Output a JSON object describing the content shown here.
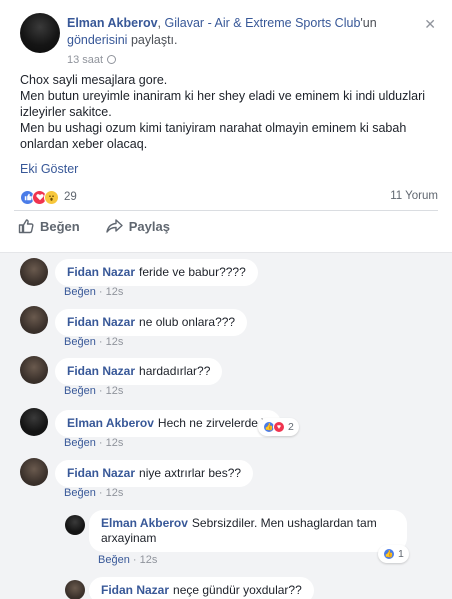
{
  "post": {
    "author": "Elman Akberov",
    "separator": ", ",
    "club": "Gilavar - Air & Extreme Sports Club",
    "club_suffix": "'un",
    "shared_word": "gönderisini",
    "shared_tail": " paylaştı.",
    "time": "13 saat",
    "close_glyph": "✕",
    "text_lines": [
      "Chox sayli mesajlara gore.",
      "Men butun ureyimle inaniram ki her shey eladi ve eminem ki indi ulduzlari izleyirler sakitce.",
      "Men bu ushagi ozum kimi taniyiram narahat olmayin eminem ki sabah onlardan xeber olacaq."
    ],
    "see_more": "Eki Göster",
    "reaction_count": "29",
    "comment_count": "11 Yorum",
    "actions": {
      "like": "Beğen",
      "share": "Paylaş"
    }
  },
  "comments": [
    {
      "author": "Fidan Nazar",
      "text": "feride ve babur????",
      "like": "Beğen",
      "time": "12s"
    },
    {
      "author": "Fidan Nazar",
      "text": "ne olub onlara???",
      "like": "Beğen",
      "time": "12s"
    },
    {
      "author": "Fidan Nazar",
      "text": "hardadırlar??",
      "like": "Beğen",
      "time": "12s"
    },
    {
      "author": "Elman Akberov",
      "text": "Hech ne zirvelerde ))",
      "like": "Beğen",
      "time": "12s",
      "reactions": "2"
    },
    {
      "author": "Fidan Nazar",
      "text": "niye axtrırlar bes??",
      "like": "Beğen",
      "time": "12s"
    }
  ],
  "reply": {
    "author": "Elman Akberov",
    "line1": "Sebrsizdiler. Men ushaglardan tam",
    "line2": "arxayinam",
    "like": "Beğen",
    "time": "12s",
    "reactions": "1"
  },
  "reply2": {
    "author": "Fidan Nazar",
    "text": "neçe gündür yoxdular??"
  },
  "colors": {
    "link": "#385898",
    "comments_bg": "#f2f3f5",
    "like_blue": "#4a7ce8",
    "love_red": "#f0344f",
    "wow_yellow": "#f7c73c"
  }
}
